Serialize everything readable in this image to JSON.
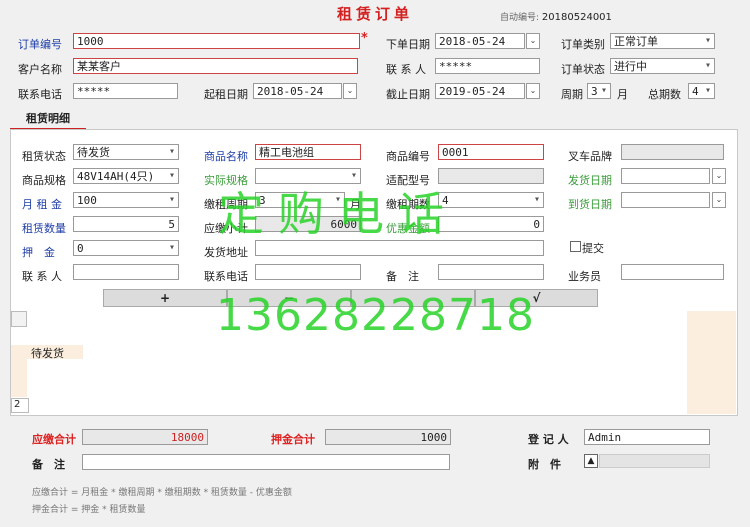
{
  "header": {
    "title": "租赁订单",
    "auto_label": "自动编号:",
    "auto_value": "20180524001"
  },
  "order": {
    "order_no_label": "订单编号",
    "order_no": "1000",
    "required_mark": "*",
    "order_date_label": "下单日期",
    "order_date": "2018-05-24",
    "order_type_label": "订单类别",
    "order_type": "正常订单",
    "customer_label": "客户名称",
    "customer": "某某客户",
    "contact_label": "联 系 人",
    "contact": "*****",
    "order_status_label": "订单状态",
    "order_status": "进行中",
    "phone_label": "联系电话",
    "phone": "*****",
    "rent_start_label": "起租日期",
    "rent_start": "2018-05-24",
    "end_label": "截止日期",
    "end": "2019-05-24",
    "cycle_label": "周期",
    "cycle": "3",
    "cycle_unit": "月",
    "periods_label": "总期数",
    "periods": "4"
  },
  "tab": {
    "label": "租赁明细"
  },
  "detail": {
    "status_label": "租赁状态",
    "status": "待发货",
    "product_name_label": "商品名称",
    "product_name": "精工电池组",
    "product_no_label": "商品编号",
    "product_no": "0001",
    "forklift_brand_label": "叉车品牌",
    "forklift_brand": "",
    "spec_label": "商品规格",
    "spec": "48V14AH(4只)",
    "actual_spec_label": "实际规格",
    "actual_spec": "",
    "fit_model_label": "适配型号",
    "fit_model": "",
    "ship_date_label": "发货日期",
    "ship_date": "",
    "rent_label": "月 租 金",
    "rent": "100",
    "pay_cycle_label": "缴租周期",
    "pay_cycle": "3",
    "pay_cycle_unit": "月",
    "pay_periods_label": "缴租期数",
    "pay_periods": "4",
    "arrive_date_label": "到货日期",
    "arrive_date": "",
    "qty_label": "租赁数量",
    "qty": "5",
    "subtotal_label": "应缴小计",
    "subtotal": "6000",
    "discount_label": "优惠金额",
    "discount": "0",
    "deposit_label": "押　金",
    "deposit": "0",
    "address_label": "发货地址",
    "address": "",
    "submit_label": "提交",
    "contact_label": "联 系 人",
    "contact": "",
    "contact_phone_label": "联系电话",
    "contact_phone": "",
    "remark_label": "备　注",
    "remark": "",
    "salesman_label": "业务员",
    "salesman": "",
    "add_btn": "+",
    "remove_btn": "−",
    "third_btn": "",
    "fourth_btn": "√",
    "grid_row_status": "待发货",
    "grid_count": "2"
  },
  "watermark": {
    "line1": "定购电话",
    "line2": "13628228718"
  },
  "footer": {
    "due_total_label": "应缴合计",
    "due_total": "18000",
    "deposit_total_label": "押金合计",
    "deposit_total": "1000",
    "registrar_label": "登 记 人",
    "registrar": "Admin",
    "remark_label": "备　注",
    "remark": "",
    "attach_label": "附　件",
    "attach_icon": "▲",
    "formula1": "应缴合计 = 月租金 * 缴租周期 * 缴租期数 * 租赁数量 - 优惠金额",
    "formula2": "押金合计 = 押金 * 租赁数量"
  }
}
